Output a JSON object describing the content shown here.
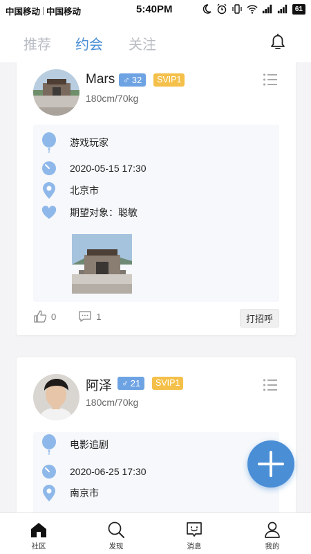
{
  "status_bar": {
    "carrier1": "中国移动",
    "carrier2": "中国移动",
    "time": "5:40PM",
    "battery": "61",
    "icons": [
      "moon-icon",
      "alarm-icon",
      "vibrate-icon",
      "wifi-icon",
      "signal-icon",
      "signal-icon",
      "battery-icon"
    ]
  },
  "top_tabs": [
    {
      "label": "推荐",
      "active": false
    },
    {
      "label": "约会",
      "active": true
    },
    {
      "label": "关注",
      "active": false
    }
  ],
  "header_icons": [
    "bell-icon"
  ],
  "cards": [
    {
      "name": "Mars",
      "gender": "♂",
      "age": "32",
      "vip": "SVIP1",
      "height_weight": "180cm/70kg",
      "activity": "游戏玩家",
      "datetime": "2020-05-15 17:30",
      "city": "北京市",
      "preference": "期望对象：聪敏",
      "likes": "0",
      "comments": "1",
      "greet": "打招呼"
    },
    {
      "name": "阿泽",
      "gender": "♂",
      "age": "21",
      "vip": "SVIP1",
      "height_weight": "180cm/70kg",
      "activity": "电影追剧",
      "datetime": "2020-06-25 17:30",
      "city": "南京市"
    }
  ],
  "bottom_nav": [
    {
      "label": "社区",
      "icon": "home-icon",
      "active": true
    },
    {
      "label": "发现",
      "icon": "search-icon",
      "active": false
    },
    {
      "label": "消息",
      "icon": "message-icon",
      "active": false
    },
    {
      "label": "我的",
      "icon": "user-icon",
      "active": false
    }
  ],
  "colors": {
    "accent": "#4a8ed6",
    "gender_badge": "#6ea3e3",
    "vip_badge": "#f4c04a",
    "inactive_tab": "#b9bcc3"
  }
}
